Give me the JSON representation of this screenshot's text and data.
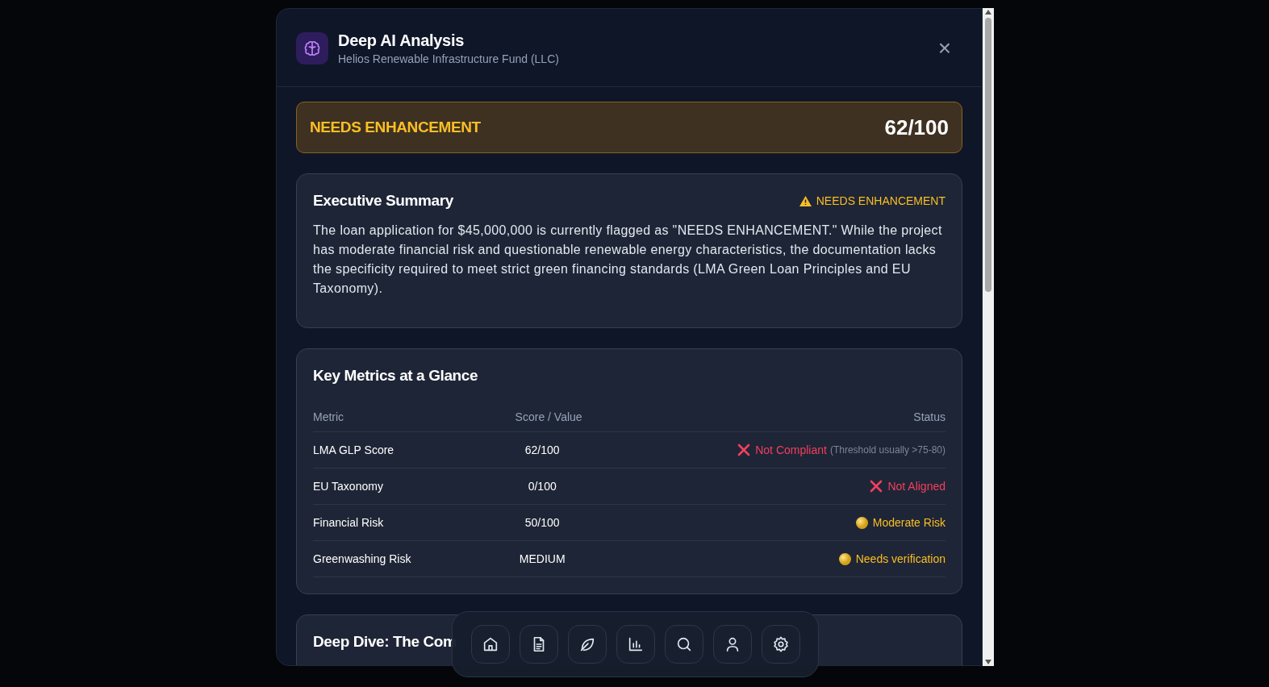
{
  "dialog": {
    "title": "Deep AI Analysis",
    "subtitle": "Helios Renewable Infrastructure Fund (LLC)",
    "close": "×"
  },
  "banner": {
    "status": "NEEDS ENHANCEMENT",
    "score": "62/100"
  },
  "summary": {
    "title": "Executive Summary",
    "badge": "NEEDS ENHANCEMENT",
    "text": "The loan application for $45,000,000 is currently flagged as \"NEEDS ENHANCEMENT.\" While the project has moderate financial risk and questionable renewable energy characteristics, the documentation lacks the specificity required to meet strict green financing standards (LMA Green Loan Principles and EU Taxonomy)."
  },
  "metrics": {
    "title": "Key Metrics at a Glance",
    "columns": [
      "Metric",
      "Score / Value",
      "Status"
    ],
    "rows": [
      {
        "metric": "LMA GLP Score",
        "value": "62/100",
        "status": "Not Compliant",
        "note": "(Threshold usually >75-80)",
        "kind": "fail"
      },
      {
        "metric": "EU Taxonomy",
        "value": "0/100",
        "status": "Not Aligned",
        "kind": "fail"
      },
      {
        "metric": "Financial Risk",
        "value": "50/100",
        "status": "Moderate Risk",
        "kind": "warn"
      },
      {
        "metric": "Greenwashing Risk",
        "value": "MEDIUM",
        "status": "Needs verification",
        "kind": "warn"
      }
    ]
  },
  "deep_dive": {
    "title": "Deep Dive: The Com"
  },
  "dock": [
    {
      "kind": "home"
    },
    {
      "kind": "document"
    },
    {
      "kind": "leaf"
    },
    {
      "kind": "chart"
    },
    {
      "kind": "search"
    },
    {
      "kind": "user"
    },
    {
      "kind": "settings"
    }
  ]
}
